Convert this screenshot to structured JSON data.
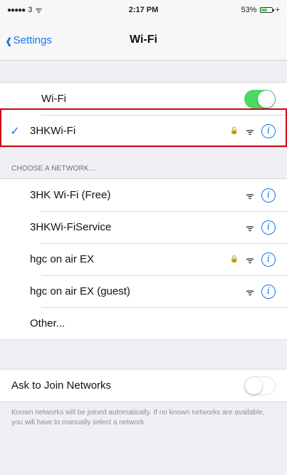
{
  "status_bar": {
    "signal_dots": "●●●●●",
    "carrier": "3",
    "wifi_glyph": "ᯤ",
    "time": "2:17 PM",
    "battery": "53%",
    "charge_glyph": "+"
  },
  "nav": {
    "back_label": "Settings",
    "back_chevron": "‹",
    "title": "Wi-Fi"
  },
  "wifi_group": {
    "wifi_label": "Wi-Fi",
    "wifi_toggle_on": true,
    "connected_network": "3HKWi-Fi",
    "checkmark": "✓",
    "connected_secured": true
  },
  "choose_section": {
    "header": "CHOOSE A NETWORK...",
    "networks": [
      {
        "name": "3HK Wi-Fi (Free)",
        "secured": false
      },
      {
        "name": "3HKWi-FiService",
        "secured": false
      },
      {
        "name": "hgc on air EX",
        "secured": true
      },
      {
        "name": "hgc on air EX (guest)",
        "secured": false
      }
    ],
    "other_label": "Other..."
  },
  "icons": {
    "lock": "🔒",
    "wifi": "ᯤ",
    "info": "i"
  },
  "ask_group": {
    "label": "Ask to Join Networks",
    "toggle_on": false,
    "footer": "Known networks will be joined automatically. If no known networks are available, you will have to manually select a network."
  },
  "colors": {
    "accent": "#1577f2",
    "toggle_on": "#4cd964",
    "highlight": "#d0021b"
  }
}
